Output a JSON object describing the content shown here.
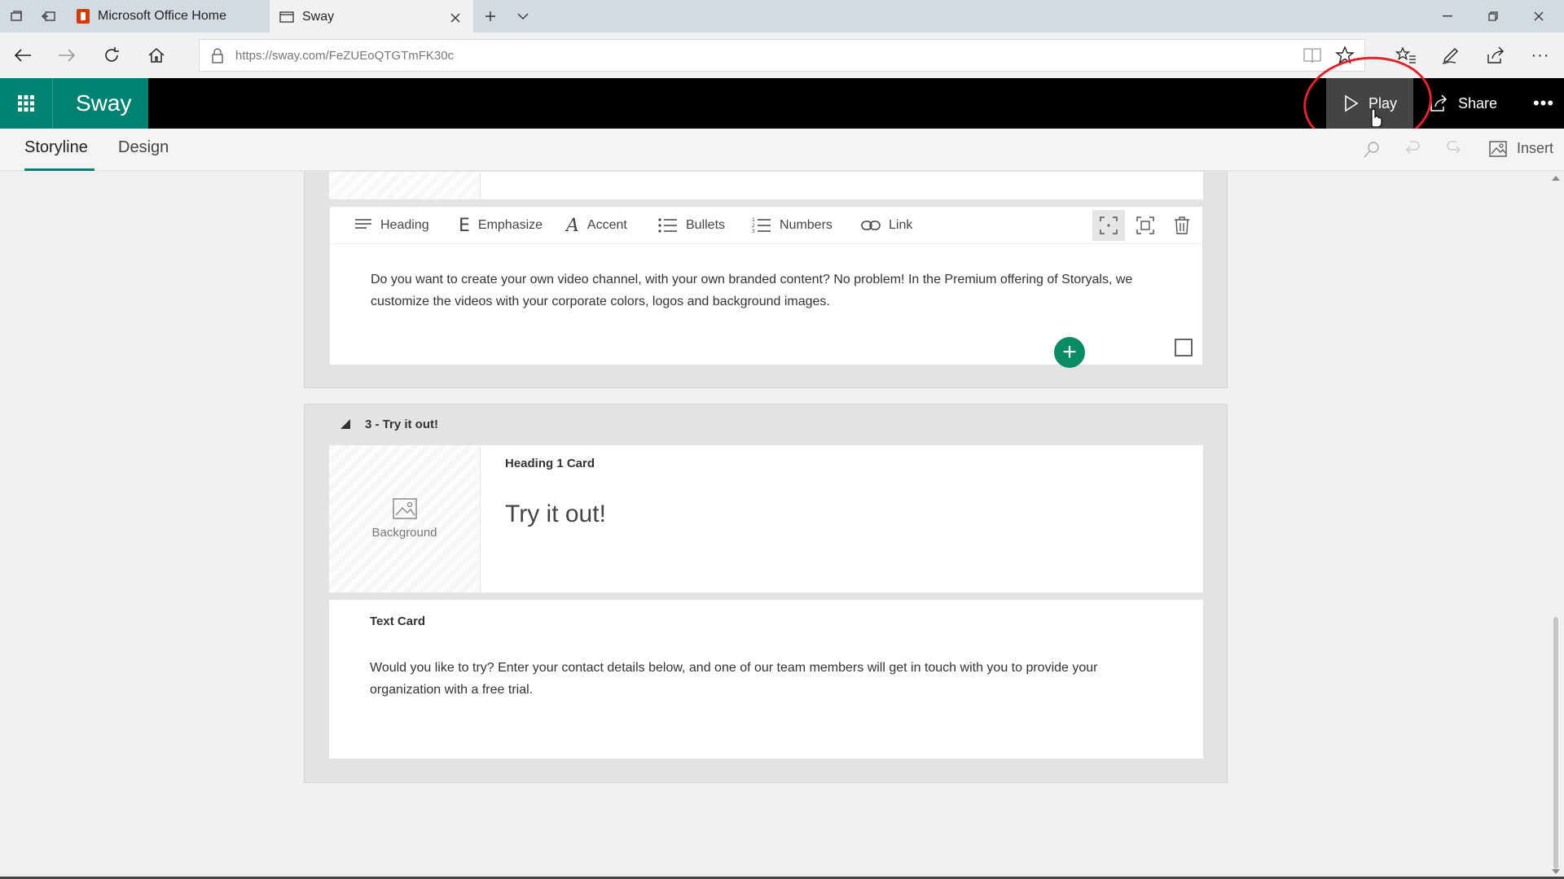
{
  "browser": {
    "tabs": [
      {
        "title": "Microsoft Office Home"
      },
      {
        "title": "Sway"
      }
    ],
    "url": "https://sway.com/FeZUEoQTGTmFK30c"
  },
  "app": {
    "brand": "Sway",
    "play_label": "Play",
    "share_label": "Share",
    "more_label": "•••",
    "tabs": {
      "storyline": "Storyline",
      "design": "Design"
    },
    "insert_label": "Insert"
  },
  "format_toolbar": {
    "heading": "Heading",
    "emphasize": "Emphasize",
    "accent": "Accent",
    "bullets": "Bullets",
    "numbers": "Numbers",
    "link": "Link"
  },
  "section_a": {
    "text": "Do you want to create your own video channel, with your own branded content? No problem! In the Premium offering of Storyals, we customize the videos with your corporate colors, logos and background images."
  },
  "section_b": {
    "title": "3 - Try it out!",
    "heading_card": {
      "label": "Heading 1 Card",
      "background_label": "Background",
      "heading": "Try it out!"
    },
    "text_card": {
      "label": "Text Card",
      "text": "Would you like to try? Enter your contact details below, and one of our team members will get in touch with you to provide your organization with a free trial."
    }
  },
  "colors": {
    "accent": "#008272",
    "add_button": "#0a8a65",
    "annotation": "#e0242e"
  }
}
